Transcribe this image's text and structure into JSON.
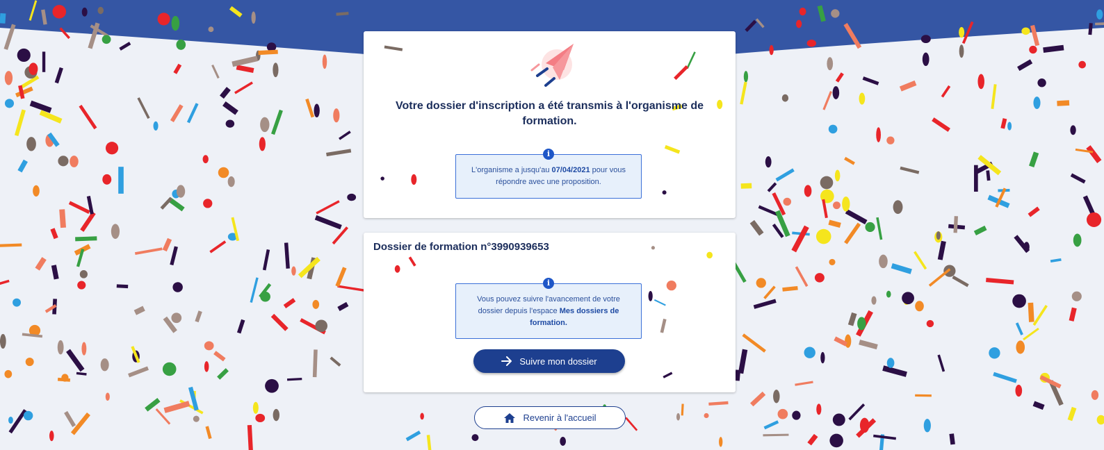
{
  "confirmation": {
    "headline": "Votre dossier d'inscription a été transmis à l'organisme de formation.",
    "info_prefix": "L'organisme a jusqu'au ",
    "deadline": "07/04/2021",
    "info_suffix": " pour vous répondre avec une proposition."
  },
  "dossier": {
    "title": "Dossier de formation n°3990939653",
    "info_prefix": "Vous pouvez suivre l'avancement de votre dossier depuis l'espace ",
    "info_link": "Mes dossiers de formation.",
    "follow_button": "Suivre mon dossier"
  },
  "home_button": "Revenir à l'accueil",
  "icons": {
    "info": "info-icon",
    "paper_plane": "paper-plane-icon",
    "arrow_right": "arrow-right-icon",
    "home": "home-icon"
  },
  "colors": {
    "header_band": "#3556a4",
    "page_background": "#eef1f7",
    "primary_button": "#1d3f8f",
    "heading": "#1b2d5b",
    "info_box": "#e7f0fb"
  }
}
